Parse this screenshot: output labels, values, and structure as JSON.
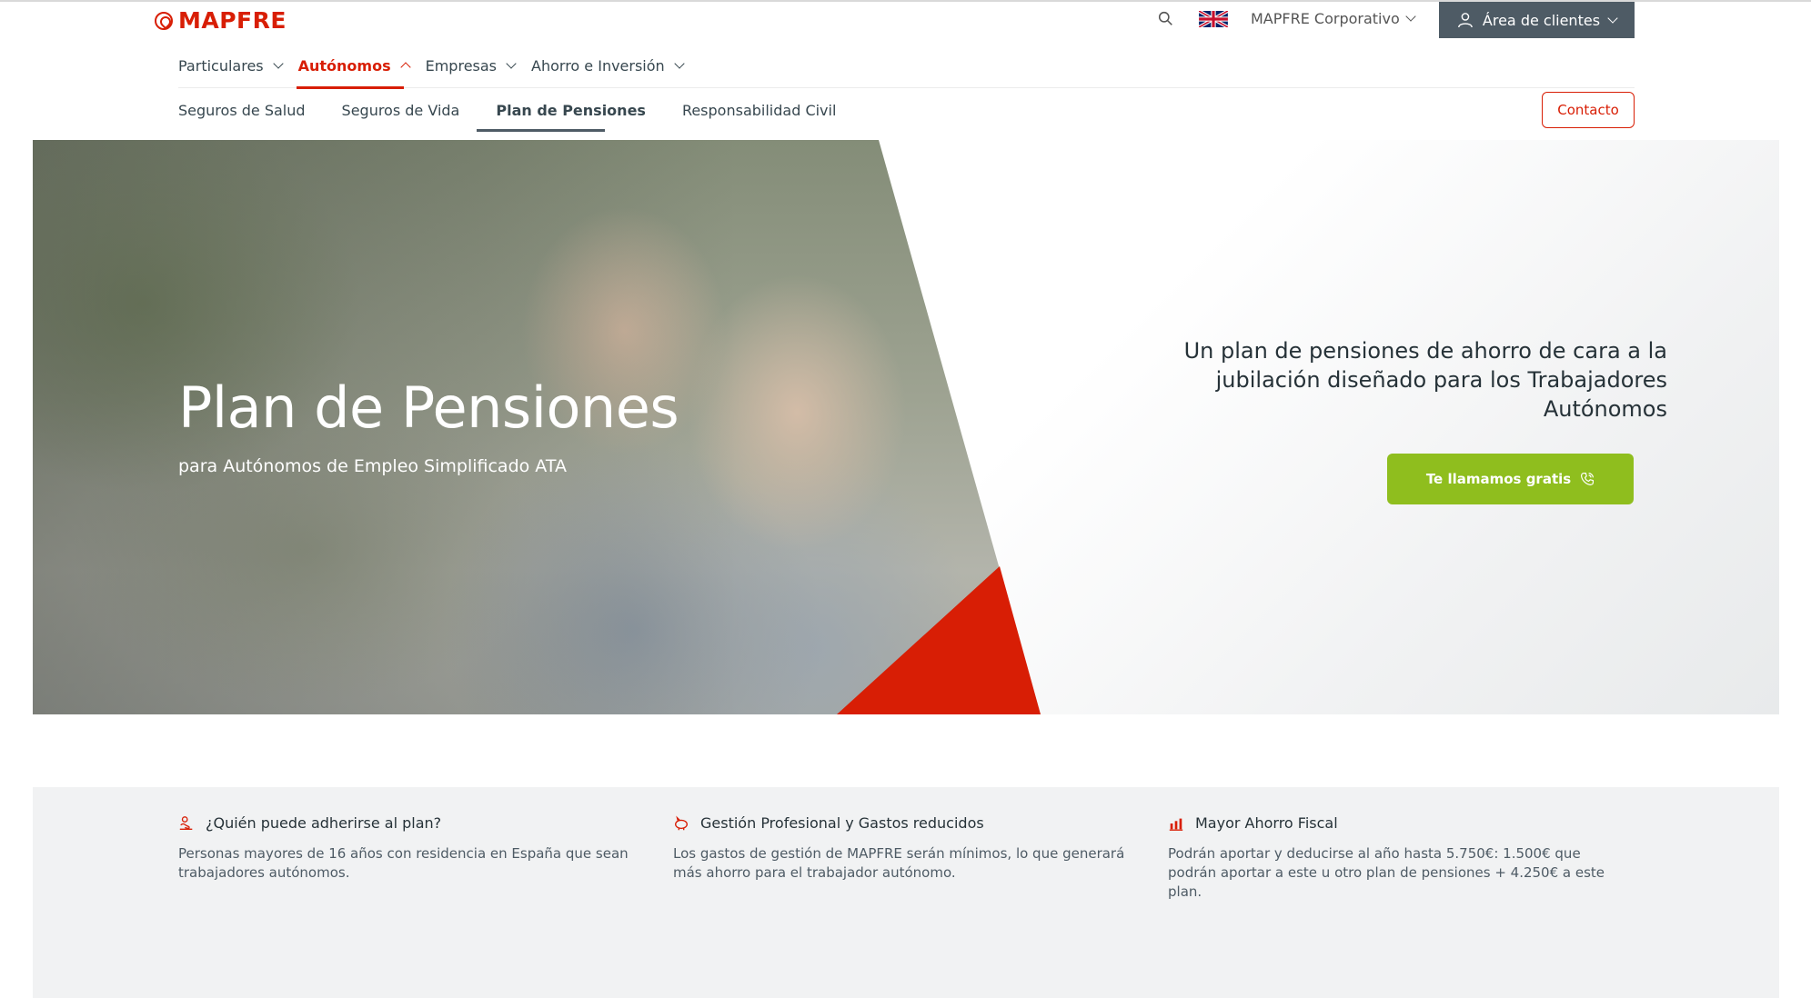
{
  "header": {
    "logo_text": "MAPFRE",
    "corporate_label": "MAPFRE Corporativo",
    "client_area_label": "Área de clientes",
    "flag_icon": "uk-flag-icon"
  },
  "main_nav": {
    "items": [
      {
        "label": "Particulares",
        "active": false
      },
      {
        "label": "Autónomos",
        "active": true
      },
      {
        "label": "Empresas",
        "active": false
      },
      {
        "label": "Ahorro e Inversión",
        "active": false
      }
    ]
  },
  "sub_nav": {
    "items": [
      {
        "label": "Seguros de Salud",
        "active": false
      },
      {
        "label": "Seguros de Vida",
        "active": false
      },
      {
        "label": "Plan de Pensiones",
        "active": true
      },
      {
        "label": "Responsabilidad Civil",
        "active": false
      }
    ],
    "contact_label": "Contacto"
  },
  "hero": {
    "title": "Plan de Pensiones",
    "subtitle": "para Autónomos de Empleo Simplificado ATA",
    "tagline": "Un plan de pensiones de ahorro de cara a la jubilación diseñado para los Trabajadores Autónomos",
    "cta_label": "Te llamamos gratis"
  },
  "features": [
    {
      "icon": "hands-icon",
      "title": "¿Quién puede adherirse al plan?",
      "text": "Personas mayores de 16 años con residencia en España que sean trabajadores autónomos."
    },
    {
      "icon": "piggy-bank-icon",
      "title": "Gestión Profesional y Gastos reducidos",
      "text": "Los gastos de gestión de MAPFRE serán mínimos, lo que generará más ahorro para el trabajador autónomo."
    },
    {
      "icon": "chart-bars-icon",
      "title": "Mayor Ahorro Fiscal",
      "text": "Podrán aportar y deducirse al año hasta 5.750€: 1.500€ que podrán aportar a este u otro plan de pensiones + 4.250€ a este plan."
    }
  ],
  "colors": {
    "brand_red": "#d81e05",
    "cta_green": "#8fbe1e",
    "client_button": "#4e5b65"
  }
}
